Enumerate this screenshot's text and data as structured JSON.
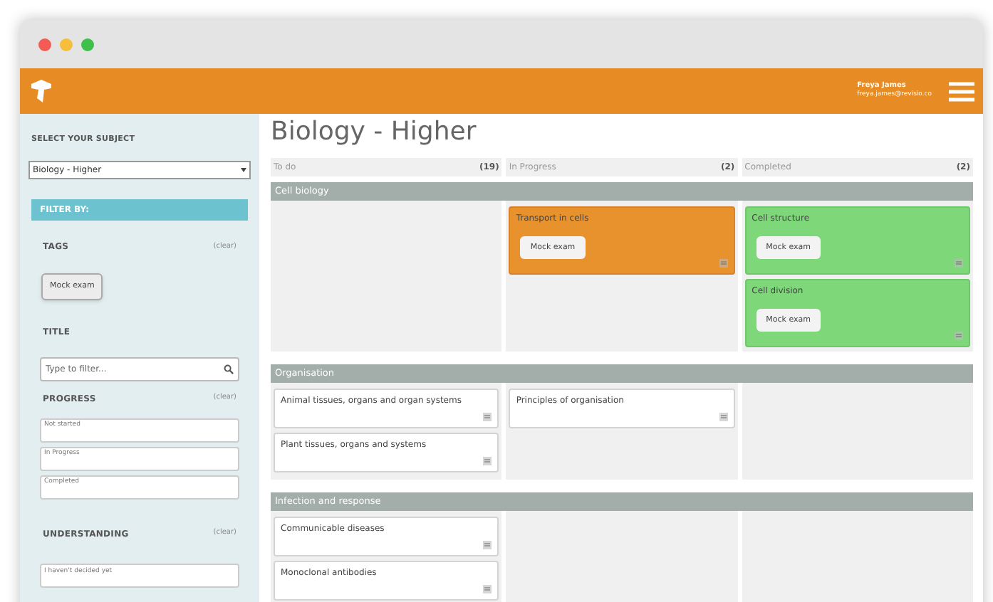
{
  "user": {
    "name": "Freya James",
    "email": "freya.james@revisio.co"
  },
  "sidebar": {
    "subject_label": "SELECT YOUR SUBJECT",
    "subject_value": "Biology - Higher",
    "filter_title": "FILTER BY:",
    "tags": {
      "label": "TAGS",
      "clear": "(clear)",
      "chips": [
        "Mock exam"
      ]
    },
    "title_filter": {
      "label": "TITLE",
      "placeholder": "Type to filter..."
    },
    "progress": {
      "label": "PROGRESS",
      "clear": "(clear)",
      "options": [
        "Not started",
        "In Progress",
        "Completed"
      ]
    },
    "understanding": {
      "label": "UNDERSTANDING",
      "clear": "(clear)",
      "options": [
        "I haven't decided yet"
      ]
    }
  },
  "page_title": "Biology - Higher",
  "columns": [
    {
      "label": "To do",
      "count": "(19)"
    },
    {
      "label": "In Progress",
      "count": "(2)"
    },
    {
      "label": "Completed",
      "count": "(2)"
    }
  ],
  "sections": [
    {
      "title": "Cell biology",
      "lanes": [
        {
          "kind": "empty"
        },
        {
          "kind": "cards",
          "cards": [
            {
              "title": "Transport in cells",
              "kind": "in_progress",
              "tags": [
                "Mock exam"
              ]
            }
          ]
        },
        {
          "kind": "cards",
          "cards": [
            {
              "title": "Cell structure",
              "kind": "completed",
              "tags": [
                "Mock exam"
              ]
            },
            {
              "title": "Cell division",
              "kind": "completed",
              "tags": [
                "Mock exam"
              ]
            }
          ]
        }
      ]
    },
    {
      "title": "Organisation",
      "lanes": [
        {
          "kind": "cards",
          "cards": [
            {
              "title": "Animal tissues, organs and organ systems",
              "kind": "plain"
            },
            {
              "title": "Plant tissues, organs and systems",
              "kind": "plain"
            }
          ]
        },
        {
          "kind": "cards",
          "cards": [
            {
              "title": "Principles of organisation",
              "kind": "plain"
            }
          ]
        },
        {
          "kind": "empty"
        }
      ]
    },
    {
      "title": "Infection and response",
      "lanes": [
        {
          "kind": "cards",
          "cards": [
            {
              "title": "Communicable diseases",
              "kind": "plain"
            },
            {
              "title": "Monoclonal antibodies",
              "kind": "plain"
            }
          ]
        },
        {
          "kind": "empty"
        },
        {
          "kind": "empty"
        }
      ]
    }
  ]
}
